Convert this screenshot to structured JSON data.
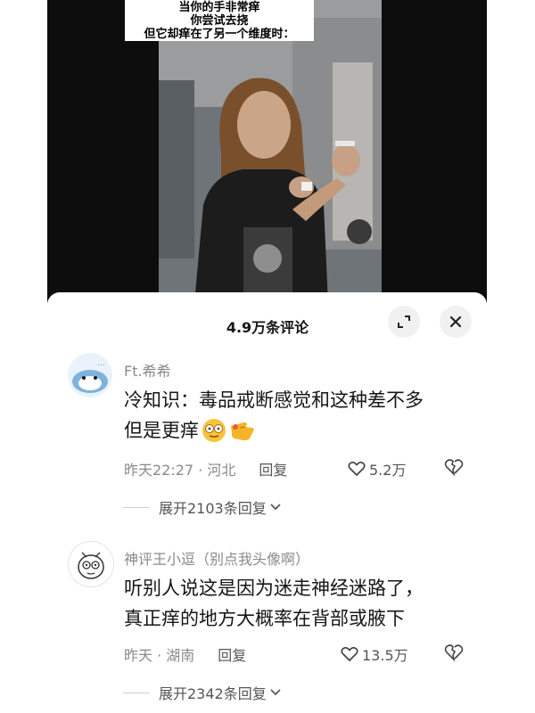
{
  "video": {
    "caption_lines": [
      "当你的手非常痒",
      "你尝试去挠",
      "但它却痒在了另一个维度时："
    ]
  },
  "comments_panel": {
    "title": "4.9万条评论",
    "expand_icon": "expand-icon",
    "close_icon": "close-icon"
  },
  "comments": [
    {
      "username": "Ft.希希",
      "text_line1": "冷知识：毒品戒断感觉和这种差不多",
      "text_line2": "但是更痒",
      "emojis": [
        "dazed-face-emoji",
        "pointing-hand-emoji"
      ],
      "time_location": "昨天22:27 · 河北",
      "reply_label": "回复",
      "likes": "5.2万",
      "expand_label": "展开2103条回复"
    },
    {
      "username": "神评王小逗（别点我头像啊）",
      "text_line1": "听别人说这是因为迷走神经迷路了，",
      "text_line2": "真正痒的地方大概率在背部或腋下",
      "time_location": "昨天 · 湖南",
      "reply_label": "回复",
      "likes": "13.5万",
      "expand_label": "展开2342条回复"
    }
  ]
}
